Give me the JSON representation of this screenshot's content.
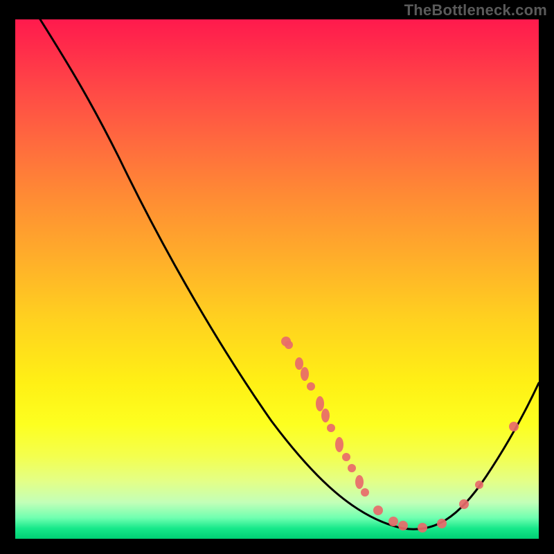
{
  "watermark": "TheBottleneck.com",
  "colors": {
    "page_bg": "#000000",
    "watermark": "#5a5a5a",
    "curve": "#000000",
    "point": "#e86a6a",
    "gradient_top": "#ff1a4d",
    "gradient_mid": "#ffd21f",
    "gradient_bottom": "#00d074"
  },
  "chart_data": {
    "type": "line",
    "title": "",
    "xlabel": "",
    "ylabel": "",
    "xlim": [
      0,
      100
    ],
    "ylim": [
      0,
      100
    ],
    "series": [
      {
        "name": "bottleneck-curve",
        "x": [
          5,
          12,
          20,
          30,
          40,
          49,
          58,
          66,
          74,
          80,
          86,
          92,
          100
        ],
        "y": [
          100,
          93,
          80,
          63,
          47,
          30,
          19,
          10,
          4,
          2,
          5,
          14,
          30
        ]
      }
    ],
    "points": {
      "name": "highlighted-points",
      "x": [
        52,
        52,
        54,
        55,
        56,
        58,
        59,
        60,
        62,
        63,
        64,
        66,
        67,
        69,
        72,
        74,
        78,
        81,
        86,
        89,
        95
      ],
      "y": [
        38,
        37,
        34,
        32,
        29,
        26,
        24,
        21,
        18,
        16,
        14,
        11,
        9,
        6,
        3,
        2,
        2,
        3,
        7,
        10,
        22
      ]
    },
    "background": {
      "type": "vertical-gradient",
      "meaning": "lower y (toward bottom) = better / green; higher y = worse / red"
    }
  }
}
